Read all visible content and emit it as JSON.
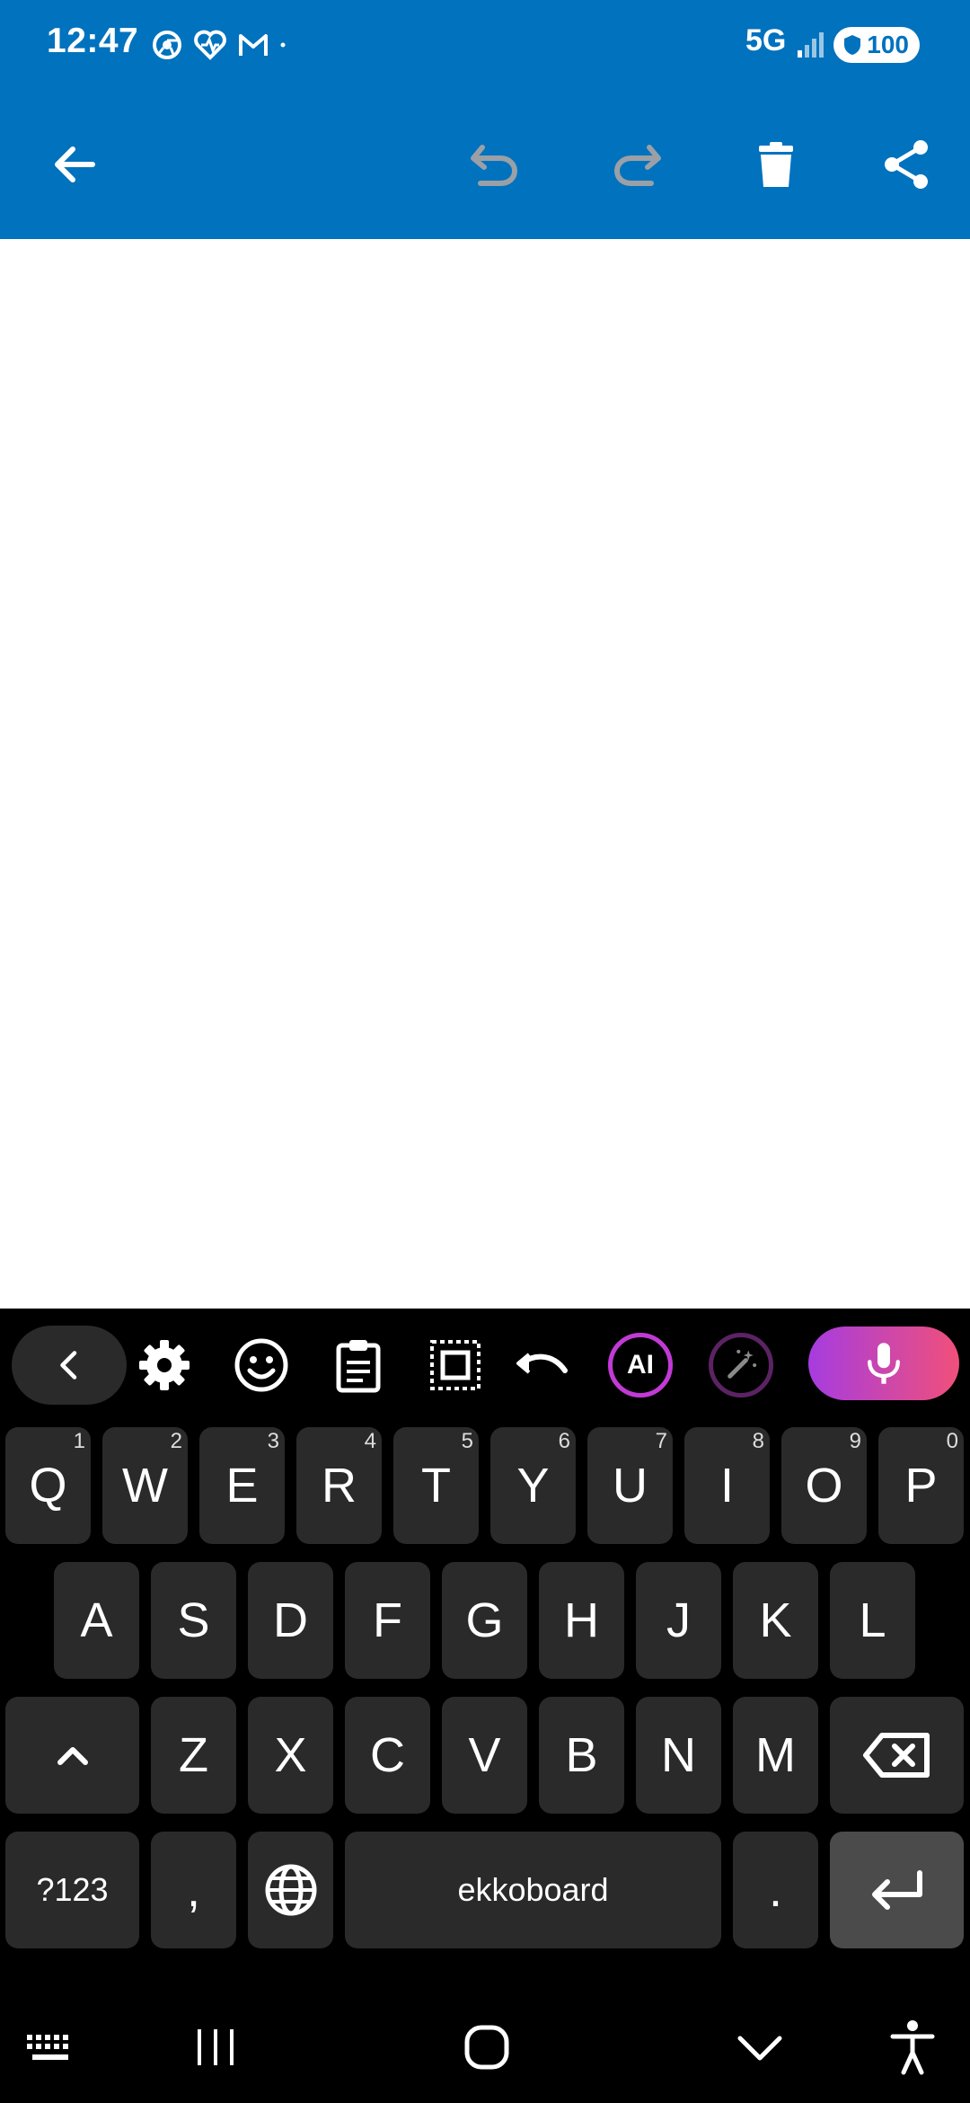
{
  "status_bar": {
    "time": "12:47",
    "network": "5G",
    "battery": "100"
  },
  "toolbar": {
    "icons": [
      "back-arrow-icon",
      "undo-icon",
      "redo-icon",
      "delete-icon",
      "share-icon"
    ]
  },
  "keyboard": {
    "toolbar_icons": [
      "collapse-chevron-icon",
      "settings-icon",
      "emoji-icon",
      "clipboard-icon",
      "select-text-icon",
      "undo-icon",
      "ai-icon",
      "magic-wand-icon",
      "microphone-icon"
    ],
    "ai_label": "AI",
    "row1": [
      {
        "label": "Q",
        "hint": "1"
      },
      {
        "label": "W",
        "hint": "2"
      },
      {
        "label": "E",
        "hint": "3"
      },
      {
        "label": "R",
        "hint": "4"
      },
      {
        "label": "T",
        "hint": "5"
      },
      {
        "label": "Y",
        "hint": "6"
      },
      {
        "label": "U",
        "hint": "7"
      },
      {
        "label": "I",
        "hint": "8"
      },
      {
        "label": "O",
        "hint": "9"
      },
      {
        "label": "P",
        "hint": "0"
      }
    ],
    "row2": [
      "A",
      "S",
      "D",
      "F",
      "G",
      "H",
      "J",
      "K",
      "L"
    ],
    "row3": [
      "Z",
      "X",
      "C",
      "V",
      "B",
      "N",
      "M"
    ],
    "symbols_label": "?123",
    "comma_label": ",",
    "space_label": "ekkoboard",
    "period_label": "."
  },
  "colors": {
    "app_bar": "#0072be",
    "keyboard_bg": "#000000",
    "key_bg": "#2a2a2a",
    "mic_gradient_start": "#a63ce0",
    "mic_gradient_end": "#f0507a"
  }
}
